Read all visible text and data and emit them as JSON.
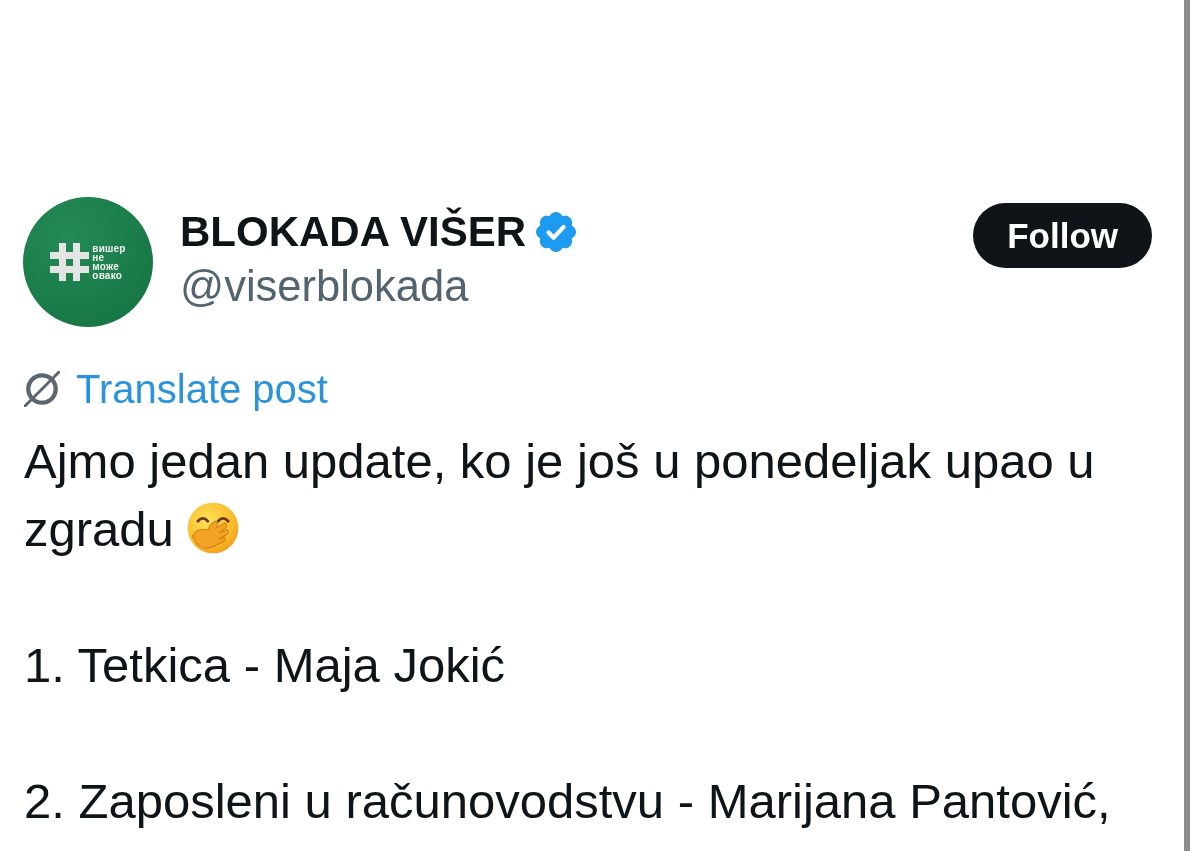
{
  "author": {
    "avatar_text": [
      "вишер",
      "не",
      "може",
      "овако"
    ],
    "name": "BLOKADA VIŠER",
    "verified": true,
    "handle": "@viserblokada"
  },
  "follow_button": {
    "label": "Follow"
  },
  "translate_link": {
    "label": "Translate post"
  },
  "post": {
    "paragraphs": [
      {
        "text": "Ajmo jedan update, ko je još u ponedeljak upao u zgradu",
        "emoji": true
      },
      {
        "text": "1. Tetkica - Maja Jokić",
        "emoji": false
      },
      {
        "text": "2. Zaposleni u računovodstvu - Marijana Pantović,",
        "emoji": false
      }
    ]
  }
}
